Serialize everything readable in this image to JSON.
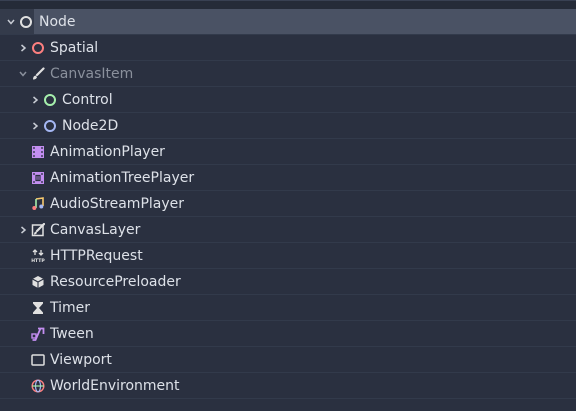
{
  "tree": {
    "items": [
      {
        "label": "Node",
        "icon": "node-circle-icon",
        "color": "#e0e0e0",
        "expanded": true
      },
      {
        "label": "Spatial",
        "icon": "spatial-circle-icon",
        "color": "#fc7f7f",
        "expanded": false
      },
      {
        "label": "CanvasItem",
        "icon": "brush-icon",
        "color": "#e0e0e0",
        "expanded": true,
        "dimmed": true
      },
      {
        "label": "Control",
        "icon": "control-circle-icon",
        "color": "#a5efac",
        "expanded": false
      },
      {
        "label": "Node2D",
        "icon": "node2d-circle-icon",
        "color": "#a5b7f3",
        "expanded": false
      },
      {
        "label": "AnimationPlayer",
        "icon": "film-icon",
        "color": "#c38ef1"
      },
      {
        "label": "AnimationTreePlayer",
        "icon": "animation-tree-icon",
        "color": "#c38ef1"
      },
      {
        "label": "AudioStreamPlayer",
        "icon": "music-note-icon",
        "color": "#f7c96e"
      },
      {
        "label": "CanvasLayer",
        "icon": "canvas-layer-icon",
        "color": "#e0e0e0",
        "expanded": false
      },
      {
        "label": "HTTPRequest",
        "icon": "http-icon",
        "color": "#e0e0e0"
      },
      {
        "label": "ResourcePreloader",
        "icon": "cube-icon",
        "color": "#e0e0e0"
      },
      {
        "label": "Timer",
        "icon": "hourglass-icon",
        "color": "#e0e0e0"
      },
      {
        "label": "Tween",
        "icon": "tween-icon",
        "color": "#c38ef1"
      },
      {
        "label": "Viewport",
        "icon": "viewport-rect-icon",
        "color": "#e0e0e0"
      },
      {
        "label": "WorldEnvironment",
        "icon": "globe-icon",
        "color": "#fc7f7f"
      }
    ]
  }
}
